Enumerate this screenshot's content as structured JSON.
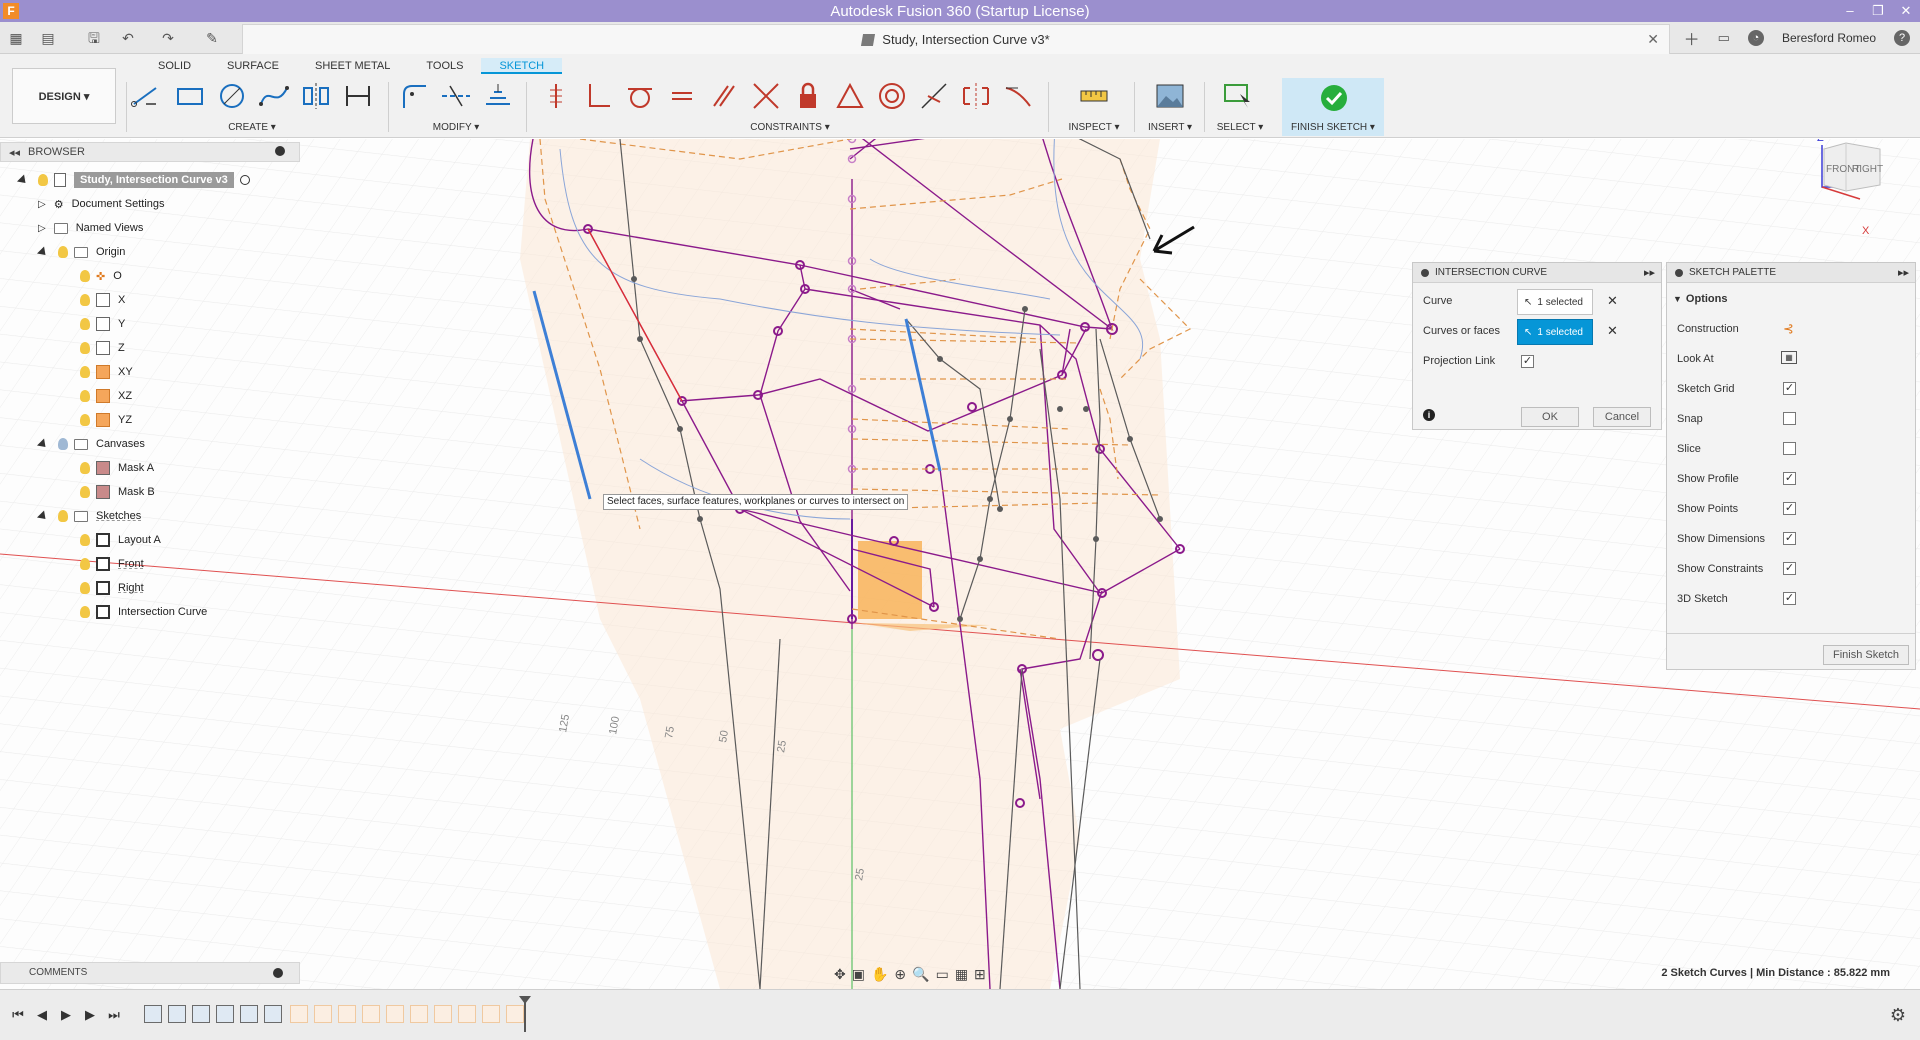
{
  "window": {
    "title": "Autodesk Fusion 360 (Startup License)"
  },
  "document_tab": {
    "title": "Study, Intersection Curve v3*"
  },
  "user": {
    "name": "Beresford Romeo"
  },
  "ribbon": {
    "tabs": [
      {
        "label": "SOLID",
        "active": false
      },
      {
        "label": "SURFACE",
        "active": false
      },
      {
        "label": "SHEET METAL",
        "active": false
      },
      {
        "label": "TOOLS",
        "active": false
      },
      {
        "label": "SKETCH",
        "active": true
      }
    ],
    "workspace_button": "DESIGN ▾",
    "groups": {
      "create": "CREATE ▾",
      "modify": "MODIFY ▾",
      "constraints": "CONSTRAINTS ▾",
      "inspect": "INSPECT ▾",
      "insert": "INSERT ▾",
      "select": "SELECT ▾",
      "finish": "FINISH SKETCH ▾"
    },
    "accent_color": "#0696d7"
  },
  "browser": {
    "title": "BROWSER",
    "root": "Study, Intersection Curve v3",
    "items": [
      {
        "label": "Document Settings",
        "icon": "gear-icon"
      },
      {
        "label": "Named Views",
        "icon": "folder-icon"
      },
      {
        "label": "Origin",
        "icon": "folder-icon"
      },
      {
        "label": "O",
        "icon": "origin-point-icon"
      },
      {
        "label": "X",
        "icon": "axis-icon"
      },
      {
        "label": "Y",
        "icon": "axis-icon"
      },
      {
        "label": "Z",
        "icon": "axis-icon"
      },
      {
        "label": "XY",
        "icon": "plane-icon"
      },
      {
        "label": "XZ",
        "icon": "plane-icon"
      },
      {
        "label": "YZ",
        "icon": "plane-icon"
      },
      {
        "label": "Canvases",
        "icon": "folder-icon"
      },
      {
        "label": "Mask A",
        "icon": "canvas-icon"
      },
      {
        "label": "Mask B",
        "icon": "canvas-icon"
      },
      {
        "label": "Sketches",
        "icon": "folder-icon"
      },
      {
        "label": "Layout A",
        "icon": "sketch-icon"
      },
      {
        "label": "Front",
        "icon": "sketch-icon"
      },
      {
        "label": "Right",
        "icon": "sketch-icon"
      },
      {
        "label": "Intersection Curve",
        "icon": "sketch-icon"
      }
    ]
  },
  "intersection_dialog": {
    "title": "INTERSECTION CURVE",
    "curve_label": "Curve",
    "curve_value": "1 selected",
    "faces_label": "Curves or faces",
    "faces_value": "1 selected",
    "projection_link_label": "Projection Link",
    "projection_link_checked": true,
    "ok": "OK",
    "cancel": "Cancel"
  },
  "sketch_palette": {
    "title": "SKETCH PALETTE",
    "section": "Options",
    "options": [
      {
        "label": "Construction",
        "type": "icon"
      },
      {
        "label": "Look At",
        "type": "icon"
      },
      {
        "label": "Sketch Grid",
        "checked": true
      },
      {
        "label": "Snap",
        "checked": false
      },
      {
        "label": "Slice",
        "checked": false
      },
      {
        "label": "Show Profile",
        "checked": true
      },
      {
        "label": "Show Points",
        "checked": true
      },
      {
        "label": "Show Dimensions",
        "checked": true
      },
      {
        "label": "Show Constraints",
        "checked": true
      },
      {
        "label": "3D Sketch",
        "checked": true
      }
    ],
    "finish_button": "Finish Sketch"
  },
  "tooltip": "Select faces, surface features, workplanes or curves to intersect on",
  "viewcube": {
    "front": "FRONT",
    "right": "RIGHT",
    "z_label": "Z",
    "x_label": "X"
  },
  "grid_labels": [
    "125",
    "100",
    "75",
    "50",
    "25",
    "25"
  ],
  "comments": {
    "label": "COMMENTS"
  },
  "status": "2 Sketch Curves | Min Distance : 85.822 mm"
}
